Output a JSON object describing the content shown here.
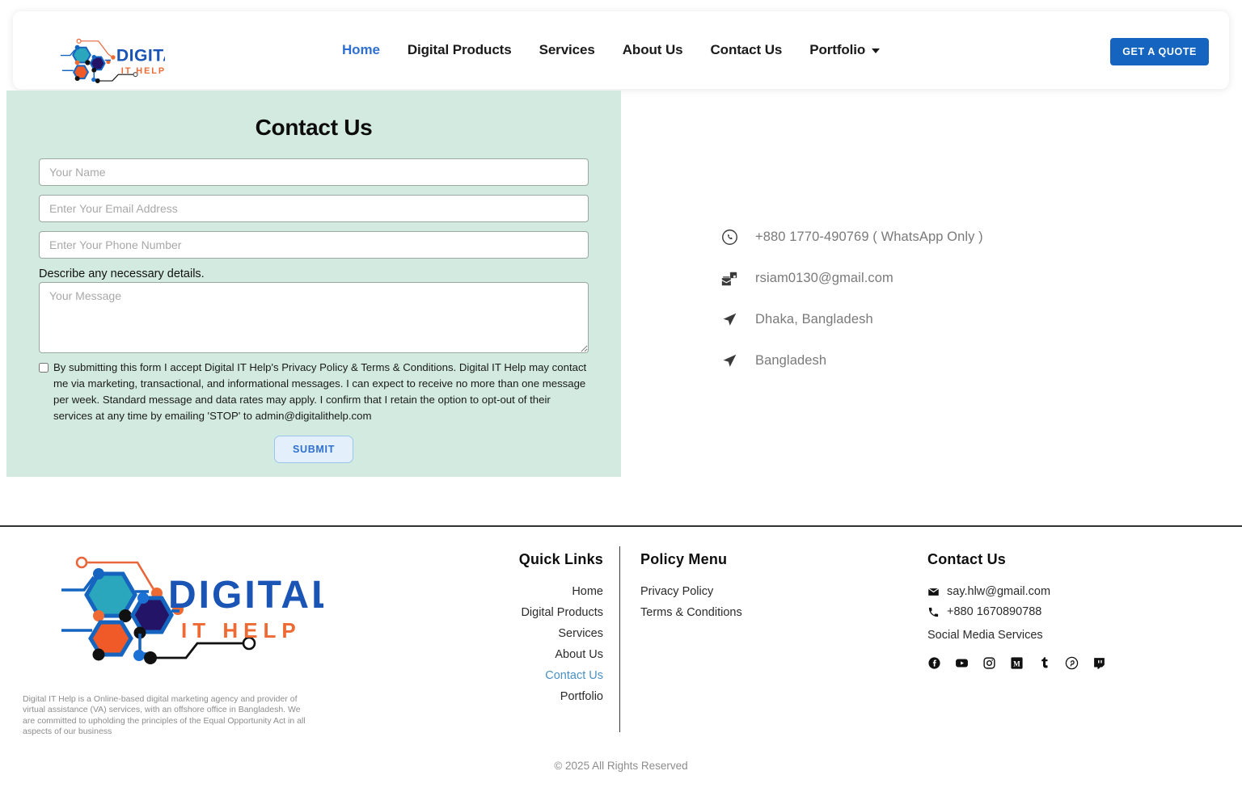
{
  "header": {
    "logo_alt": "Digital IT Help",
    "logo_word_main": "DIGITAL",
    "logo_word_sub": "IT HELP",
    "nav": [
      {
        "label": "Home",
        "active": true,
        "has_caret": false
      },
      {
        "label": "Digital Products",
        "active": false,
        "has_caret": false
      },
      {
        "label": "Services",
        "active": false,
        "has_caret": false
      },
      {
        "label": "About Us",
        "active": false,
        "has_caret": false
      },
      {
        "label": "Contact Us",
        "active": false,
        "has_caret": false
      },
      {
        "label": "Portfolio",
        "active": false,
        "has_caret": true
      }
    ],
    "quote_button": "GET A QUOTE",
    "accent_color": "#1565c0",
    "active_link_color": "#2f6fd0"
  },
  "contact_form": {
    "title": "Contact Us",
    "panel_background": "#d2eae0",
    "name_placeholder": "Your Name",
    "name_value": "",
    "email_placeholder": "Enter Your Email Address",
    "email_value": "",
    "phone_placeholder": "Enter Your Phone Number",
    "phone_value": "",
    "details_label": "Describe any necessary details.",
    "message_placeholder": "Your Message",
    "message_value": "",
    "consent_checked": false,
    "consent_text": "By submitting this form I accept Digital IT Help's Privacy Policy & Terms & Conditions. Digital IT Help may contact me via marketing, transactional, and informational messages. I can expect to receive no more than one message per week. Standard message and data rates may apply. I confirm that I retain the option to opt-out of their services at any time by emailing 'STOP' to admin@digitalithelp.com",
    "submit_label": "SUBMIT"
  },
  "contact_info": [
    {
      "icon": "whatsapp-icon",
      "text": "+880 1770-490769 ( WhatsApp Only )"
    },
    {
      "icon": "mail-inbox-icon",
      "text": "rsiam0130@gmail.com"
    },
    {
      "icon": "location-arrow-icon",
      "text": "Dhaka, Bangladesh"
    },
    {
      "icon": "location-arrow-icon",
      "text": "Bangladesh"
    }
  ],
  "footer": {
    "description": "Digital IT Help is a Online-based digital marketing agency and provider of virtual assistance (VA) services, with an offshore office in Bangladesh. We are committed to upholding the principles of the Equal Opportunity Act in all aspects of our business",
    "quick_links": {
      "heading": "Quick Links",
      "items": [
        {
          "label": "Home",
          "active": false
        },
        {
          "label": "Digital Products",
          "active": false
        },
        {
          "label": "Services",
          "active": false
        },
        {
          "label": "About Us",
          "active": false
        },
        {
          "label": "Contact Us",
          "active": true
        },
        {
          "label": "Portfolio",
          "active": false
        }
      ]
    },
    "policy_menu": {
      "heading": "Policy Menu",
      "items": [
        {
          "label": "Privacy Policy"
        },
        {
          "label": "Terms & Conditions"
        }
      ]
    },
    "contact": {
      "heading": "Contact Us",
      "email": "say.hlw@gmail.com",
      "phone": "+880 1670890788",
      "social_label": "Social Media Services",
      "socials": [
        "facebook-icon",
        "youtube-icon",
        "instagram-icon",
        "medium-icon",
        "tumblr-icon",
        "pinterest-icon",
        "twitch-icon"
      ]
    },
    "copyright": "© 2025 All Rights Reserved",
    "active_link_color": "#4a90c4"
  }
}
